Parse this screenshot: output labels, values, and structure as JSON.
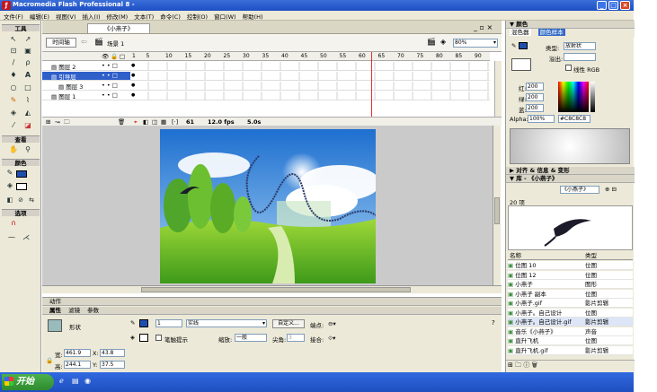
{
  "window": {
    "title": "Macromedia Flash Professional 8 - ",
    "controls": [
      "_",
      "□",
      "×"
    ]
  },
  "menu": [
    "文件(F)",
    "编辑(E)",
    "视图(V)",
    "插入(I)",
    "修改(M)",
    "文本(T)",
    "命令(C)",
    "控制(O)",
    "窗口(W)",
    "帮助(H)"
  ],
  "tools": {
    "title": "工具",
    "view_label": "查看",
    "colors_label": "颜色",
    "options_label": "选项"
  },
  "document": {
    "tab": "《小燕子》",
    "timeline_button": "时间轴",
    "scene": "场景 1",
    "zoom": "80%"
  },
  "timeline": {
    "ruler": [
      "1",
      "5",
      "10",
      "15",
      "20",
      "25",
      "30",
      "35",
      "40",
      "45",
      "50",
      "55",
      "60",
      "65",
      "70",
      "75",
      "80",
      "85",
      "90"
    ],
    "layers": [
      {
        "name": "图层 2",
        "selected": false
      },
      {
        "name": "引导层",
        "selected": true
      },
      {
        "name": "图层 3",
        "selected": false
      },
      {
        "name": "图层 1",
        "selected": false
      }
    ],
    "current_frame": "61",
    "fps": "12.0 fps",
    "time": "5.0s",
    "playhead_fraction": 0.67
  },
  "properties": {
    "section_actions": "动作",
    "tabs": [
      "属性",
      "滤镜",
      "参数"
    ],
    "shape_label": "形状",
    "stroke_width": "1",
    "stroke_style": "实线",
    "custom_button": "自定义...",
    "cap_label": "端点:",
    "hinting_label": "笔触提示",
    "scale_label": "缩放:",
    "scale_value": "一般",
    "miter_label": "尖角:",
    "miter_value": "3",
    "join_label": "接合:",
    "w_label": "宽:",
    "w": "461.9",
    "x_label": "X:",
    "x": "43.8",
    "h_label": "高:",
    "h": "244.1",
    "y_label": "Y:",
    "y": "37.5"
  },
  "color_panel": {
    "title": "颜色",
    "tabs": [
      "混色器",
      "颜色样本"
    ],
    "type_label": "类型:",
    "type_value": "放射状",
    "overflow_label": "溢出:",
    "linear_rgb": "线性 RGB",
    "r_label": "红:",
    "r": "200",
    "g_label": "绿:",
    "g": "200",
    "b_label": "蓝:",
    "b": "200",
    "alpha_label": "Alpha:",
    "alpha": "100%",
    "hex": "#C8C8C8"
  },
  "align_panel": {
    "title": "对齐 & 信息 & 变形"
  },
  "library": {
    "title": "库 - 《小燕子》",
    "selector": "《小燕子》",
    "count": "20 项",
    "col_name": "名称",
    "col_type": "类型",
    "items": [
      {
        "name": "位图 10",
        "type": "位图"
      },
      {
        "name": "位图 12",
        "type": "位图"
      },
      {
        "name": "小燕子",
        "type": "图形"
      },
      {
        "name": "小燕子 副本",
        "type": "位图"
      },
      {
        "name": "小燕子.gif",
        "type": "影片剪辑"
      },
      {
        "name": "小燕子。自己设计",
        "type": "位图"
      },
      {
        "name": "小燕子。自己设计.gif",
        "type": "影片剪辑"
      },
      {
        "name": "音乐《小燕子》",
        "type": "声音"
      },
      {
        "name": "直升飞机",
        "type": "位图"
      },
      {
        "name": "直升飞机.gif",
        "type": "影片剪辑"
      }
    ]
  },
  "taskbar": {
    "start": "开始"
  },
  "colors": {
    "titlebar": "#1d4fc4",
    "selection": "#2f5fc9",
    "panel": "#ece9d8",
    "playhead": "#e03030"
  }
}
